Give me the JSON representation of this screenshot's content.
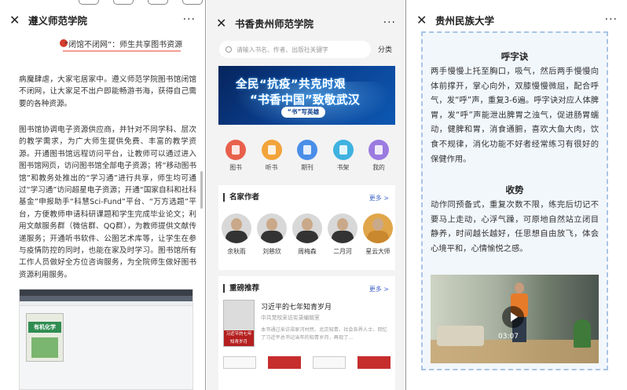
{
  "panel1": {
    "title": "遵义师范学院",
    "more": "···",
    "heading": "“闭馆不闭网”：师生共享图书资源",
    "paragraphs": [
      "病魔肆虐，大家宅居家中。遵义师范学院图书馆闭馆不闭网，让大家足不出户即能畅游书海，获得自己需要的各种资源。",
      "图书馆协调电子资源供应商，并针对不同学科、层次的教学需求，为广大师生提供免费、丰富的教学资源。开通图书馆远程访问平台，让教师可以通过进入图书馆网页，访问图书馆全部电子资源；将“移动图书馆”和教务处推出的“学习通”进行共享，师生均可通过“学习通”访问超星电子资源；开通“国家自科和社科基金”申报助手“科慧Sci-Fund”平台、“万方选题”平台，方便教师申请科研课题和学生完成毕业论文；利用文献服务群（微信群、QQ群），为教师提供文献传递服务；开通听书软件、公图艺术库等，让学生在参与疫情防控的同时，也能在家及时学习。图书馆所有工作人员做好全方位咨询服务，为全院师生做好图书资源利用服务。"
    ],
    "book_title": "有机化学"
  },
  "panel2": {
    "title": "书香贵州师范学院",
    "more": "···",
    "search_placeholder": "请输入书名、作者、出版社关键字",
    "category": "分类",
    "banner": {
      "line1": "全民“抗疫”共克时艰",
      "line2": "“书香中国”致敬武汉",
      "button": "“书”写英雄"
    },
    "icons": [
      {
        "label": "图书",
        "color": "#e8604c"
      },
      {
        "label": "听书",
        "color": "#f2a33a"
      },
      {
        "label": "期刊",
        "color": "#4a8ee8"
      },
      {
        "label": "书架",
        "color": "#3fb2e0"
      },
      {
        "label": "我的",
        "color": "#9b7be0"
      }
    ],
    "authors_section": {
      "title": "名家作者",
      "more": "更多 >",
      "authors": [
        "余秋雨",
        "刘慈欣",
        "周梅森",
        "二月河",
        "星云大师"
      ]
    },
    "rec_section": {
      "title": "重磅推荐",
      "more": "更多 >",
      "book_title": "习近平的七年知青岁月",
      "book_sub": "中共党校采访实录编辑室",
      "book_desc": "本书通过采访梁家河村民、北京知青、社会各界人士，回忆了习近平总书记当年的知青岁月，再现了...",
      "cover_text": "习近平的七年知青岁月"
    }
  },
  "panel3": {
    "title": "贵州民族大学",
    "more": "···",
    "section1_title": "呼字诀",
    "section1_text": "两手慢慢上托至胸口，吸气，然后两手慢慢向体前撑开，掌心向外，双膝慢慢微屈，配合呼气，发“呼”声，重复3-6遍。呼字诀对应人体脾胃，发“呼”声能泄出脾胃之浊气，促进肠胃蠕动，健脾和胃，消食通腑，喜欢大鱼大肉，饮食不规律，消化功能不好者经常练习有很好的保健作用。",
    "section2_title": "收势",
    "section2_text": "动作同预备式，重复次数不限，练完后切记不要马上走动，心浮气躁，可原地自然站立闭目静养，时间越长越好，任思想自由放飞，体会心境平和，心情愉悦之感。",
    "video_duration": "03:07"
  }
}
